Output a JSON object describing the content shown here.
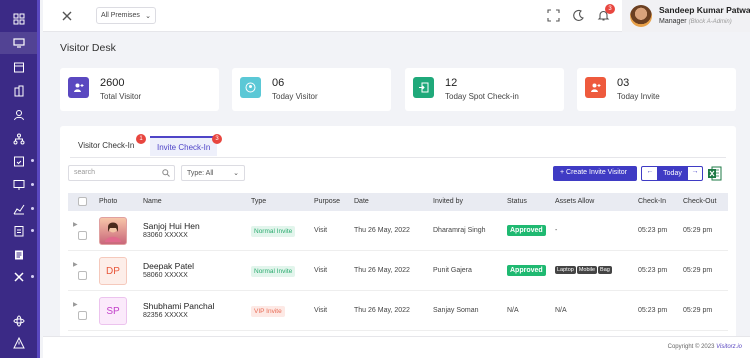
{
  "header": {
    "premises": "All Premises",
    "notification_count": "3",
    "user_name": "Sandeep Kumar Patwa",
    "user_role": "Manager",
    "user_role_sub": "(Block A-Admin)"
  },
  "page_title": "Visitor Desk",
  "stats": [
    {
      "value": "2600",
      "label": "Total Visitor",
      "color": "#5a48c0"
    },
    {
      "value": "06",
      "label": "Today Visitor",
      "color": "#5bc8d6"
    },
    {
      "value": "12",
      "label": "Today Spot Check-in",
      "color": "#1fa97a"
    },
    {
      "value": "03",
      "label": "Today Invite",
      "color": "#ee5a3d"
    }
  ],
  "tabs": [
    {
      "label": "Visitor Check-In",
      "badge": "1"
    },
    {
      "label": "Invite Check-In",
      "badge": "3"
    }
  ],
  "filters": {
    "search_placeholder": "search",
    "type_value": "Type: All"
  },
  "toolbar": {
    "create_label": "Create Invite Visitor",
    "today_label": "Today",
    "prev": "←",
    "next": "→"
  },
  "table": {
    "columns": [
      "Photo",
      "Name",
      "Type",
      "Purpose",
      "Date",
      "Invited by",
      "Status",
      "Assets Allow",
      "Check-In",
      "Check-Out"
    ],
    "rows": [
      {
        "initials": "",
        "name": "Sanjoj Hui Hen",
        "phone": "83060 XXXXX",
        "type": "Normal Invite",
        "purpose": "Visit",
        "date": "Thu 26 May, 2022",
        "invited_by": "Dharamraj Singh",
        "status": "Approved",
        "assets": "-",
        "check_in": "05:23 pm",
        "check_out": "05:29 pm"
      },
      {
        "initials": "DP",
        "name": "Deepak Patel",
        "phone": "58060 XXXXX",
        "type": "Normal Invite",
        "purpose": "Visit",
        "date": "Thu 26 May, 2022",
        "invited_by": "Punit Gajera",
        "status": "Approved",
        "assets_list": [
          "Laptop",
          "Mobile",
          "Bag"
        ],
        "check_in": "05:23 pm",
        "check_out": "05:29 pm"
      },
      {
        "initials": "SP",
        "name": "Shubhami Panchal",
        "phone": "82356 XXXXX",
        "type": "VIP Invite",
        "purpose": "Visit",
        "date": "Thu 26 May, 2022",
        "invited_by": "Sanjay Soman",
        "status": "N/A",
        "assets": "N/A",
        "check_in": "05:23 pm",
        "check_out": "05:29 pm"
      }
    ]
  },
  "footer": {
    "text": "Copyright © 2023",
    "brand": "Visitorz.io"
  }
}
